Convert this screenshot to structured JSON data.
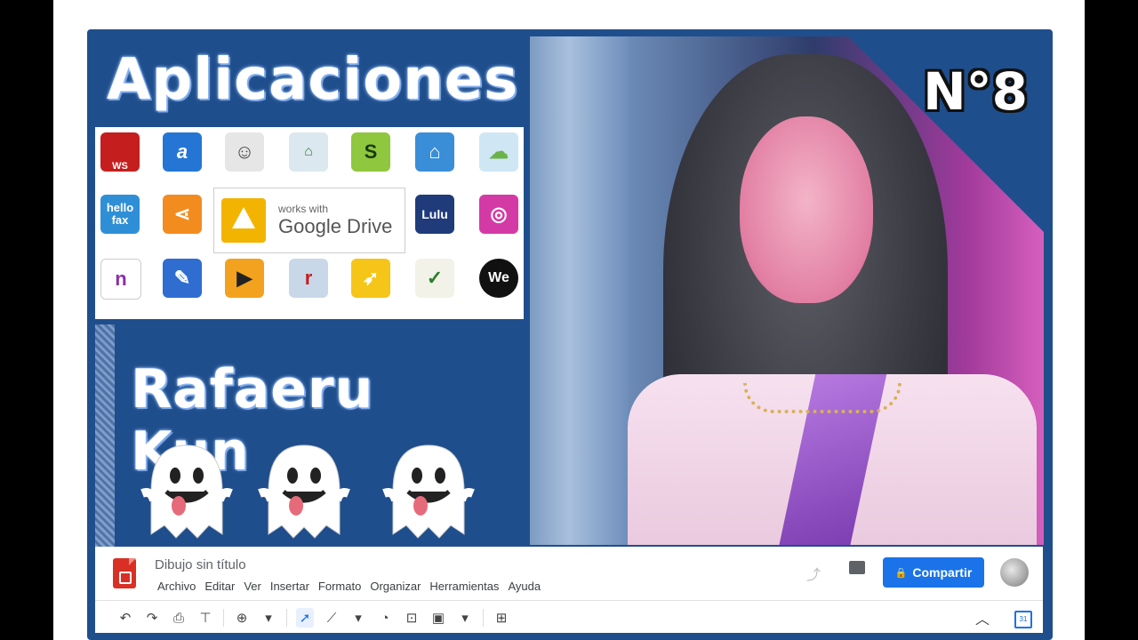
{
  "thumbnail": {
    "title": "Aplicaciones",
    "author": "Rafaeru Kun",
    "episode": "N°8"
  },
  "app_grid": {
    "tiles": [
      {
        "name": "autocad-ws",
        "color": "#c41e1e",
        "label": "WS"
      },
      {
        "name": "lucid-a",
        "color": "#2576d4",
        "label": "a"
      },
      {
        "name": "sketch-face",
        "color": "#e6e6e6",
        "label": ""
      },
      {
        "name": "floor-plan",
        "color": "#dbe8ef",
        "label": ""
      },
      {
        "name": "s-app",
        "color": "#8fc73e",
        "label": "S"
      },
      {
        "name": "home-app",
        "color": "#3a8ed8",
        "label": ""
      },
      {
        "name": "cloud-app",
        "color": "#cfe6f4",
        "label": ""
      },
      {
        "name": "hellofax",
        "color": "#2f8fd6",
        "label": "hello fax"
      },
      {
        "name": "share-app",
        "color": "#f28c1e",
        "label": ""
      },
      {
        "name": "lulu",
        "color": "#1f3b7a",
        "label": "Lulu"
      },
      {
        "name": "orbit-app",
        "color": "#d43aa6",
        "label": ""
      },
      {
        "name": "n-app",
        "color": "#ffffff",
        "label": "n"
      },
      {
        "name": "pen-app",
        "color": "#2f6dd1",
        "label": ""
      },
      {
        "name": "play-app",
        "color": "#f2a21e",
        "label": ""
      },
      {
        "name": "r-app",
        "color": "#c9d8e8",
        "label": "r"
      },
      {
        "name": "rocket-app",
        "color": "#f5c518",
        "label": ""
      },
      {
        "name": "check-app",
        "color": "#f2f2e8",
        "label": "✓"
      },
      {
        "name": "we-app",
        "color": "#111111",
        "label": "We"
      }
    ],
    "drive_badge": {
      "line1": "works with",
      "line2": "Google Drive"
    }
  },
  "drawings_ui": {
    "doc_title": "Dibujo sin título",
    "menu": [
      "Archivo",
      "Editar",
      "Ver",
      "Insertar",
      "Formato",
      "Organizar",
      "Herramientas",
      "Ayuda"
    ],
    "share_label": "Compartir",
    "toolbar_icons": [
      "undo-icon",
      "redo-icon",
      "print-icon",
      "paint-format-icon",
      "zoom-icon",
      "select-icon",
      "line-icon",
      "shape-icon",
      "textbox-icon",
      "image-icon",
      "add-comment-icon"
    ]
  },
  "colors": {
    "frame": "#1f4e8c",
    "share_button": "#1a73e8"
  }
}
